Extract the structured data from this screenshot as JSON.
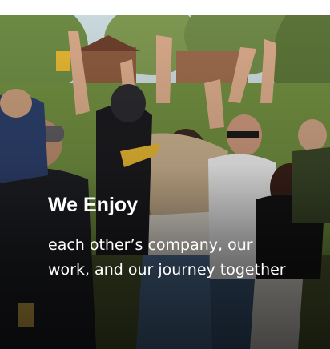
{
  "card": {
    "heading": "We Enjoy",
    "body": "each other’s company, our work, and our journey together",
    "photo_subject": "team-celebration-photo"
  },
  "colors": {
    "text": "#ffffff",
    "overlay": "#000000",
    "foliage": "#5d7a3a",
    "sky": "#c9d8dc"
  }
}
